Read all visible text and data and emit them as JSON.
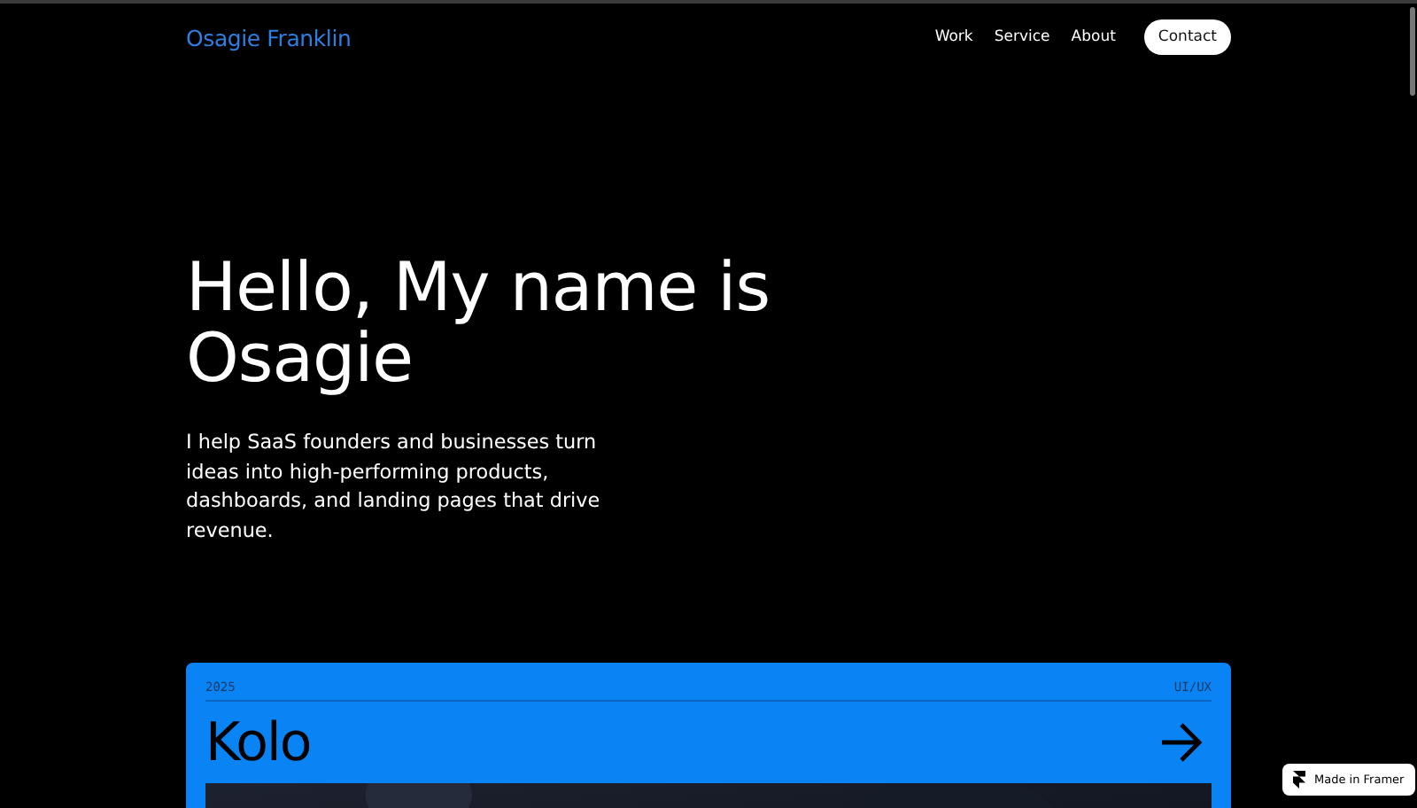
{
  "header": {
    "logo": "Osagie Franklin",
    "nav": [
      {
        "label": "Work",
        "kind": "link"
      },
      {
        "label": "Service",
        "kind": "link"
      },
      {
        "label": "About",
        "kind": "link"
      },
      {
        "label": "Contact",
        "kind": "button"
      }
    ]
  },
  "hero": {
    "heading": "Hello, My name is Osagie",
    "text": "I help SaaS founders and businesses turn ideas into high-performing products, dashboards, and landing pages that drive revenue."
  },
  "projects": [
    {
      "year": "2025",
      "category": "UI/UX",
      "title": "Kolo"
    }
  ],
  "badge": {
    "label": "Made in Framer"
  }
}
